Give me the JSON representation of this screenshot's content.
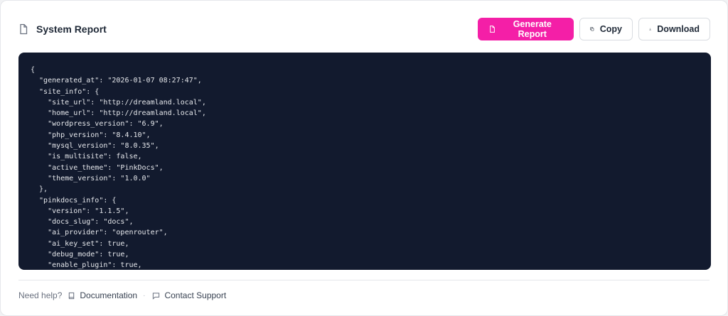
{
  "header": {
    "title": "System Report",
    "title_icon": "document-icon"
  },
  "actions": {
    "generate_label": "Generate Report",
    "copy_label": "Copy",
    "download_label": "Download"
  },
  "report": {
    "lines": [
      "{",
      "  \"generated_at\": \"2026-01-07 08:27:47\",",
      "  \"site_info\": {",
      "    \"site_url\": \"http://dreamland.local\",",
      "    \"home_url\": \"http://dreamland.local\",",
      "    \"wordpress_version\": \"6.9\",",
      "    \"php_version\": \"8.4.10\",",
      "    \"mysql_version\": \"8.0.35\",",
      "    \"is_multisite\": false,",
      "    \"active_theme\": \"PinkDocs\",",
      "    \"theme_version\": \"1.0.0\"",
      "  },",
      "  \"pinkdocs_info\": {",
      "    \"version\": \"1.1.5\",",
      "    \"docs_slug\": \"docs\",",
      "    \"ai_provider\": \"openrouter\",",
      "    \"ai_key_set\": true,",
      "    \"debug_mode\": true,",
      "    \"enable_plugin\": true,",
      "    \"..."
    ]
  },
  "footer": {
    "help_text": "Need help?",
    "documentation_label": "Documentation",
    "separator": "·",
    "support_label": "Contact Support"
  },
  "colors": {
    "accent": "#f41fa7",
    "code_bg": "#121a2e"
  }
}
